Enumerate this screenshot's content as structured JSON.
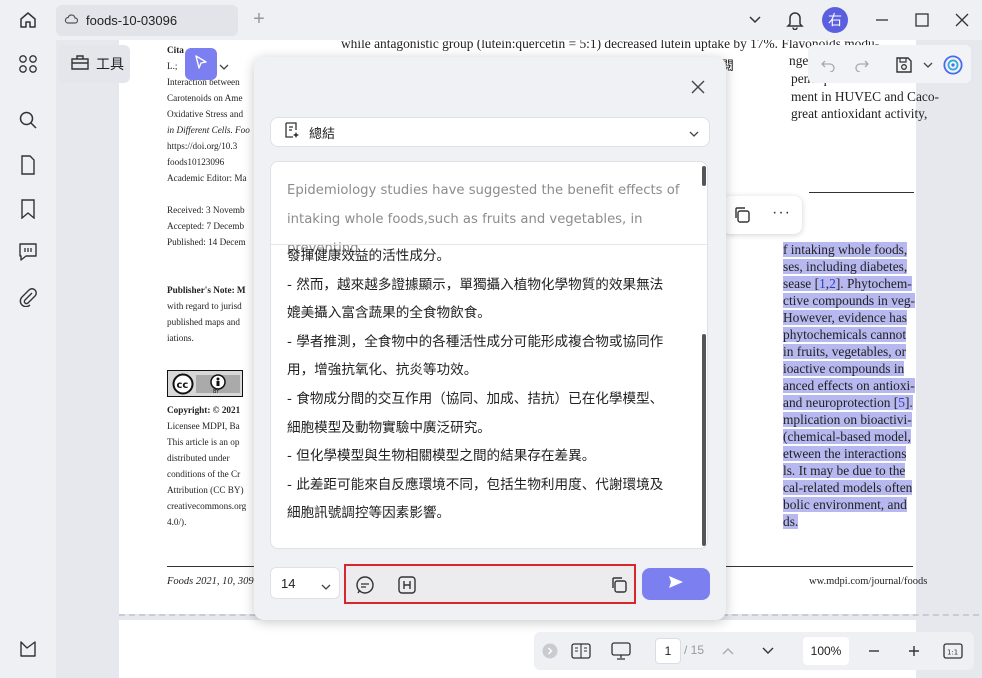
{
  "titlebar": {
    "tab_title": "foods-10-03096",
    "tab_add": "+",
    "avatar_text": "右"
  },
  "toolbar": {
    "tools_label": "工具",
    "partial_label": "閱"
  },
  "document": {
    "left_column": [
      "Cita",
      "L.;",
      "Interaction between",
      "Carotenoids on Ame",
      "Oxidative Stress and",
      "in Different Cells. Foo",
      "https://doi.org/10.3",
      "foods10123096",
      "",
      "Academic Editor: Ma",
      "",
      "Received: 3 Novemb",
      "Accepted: 7 Decemb",
      "Published: 14 Decem",
      "",
      "",
      "Publisher's Note: M",
      "with regard to jurisd",
      "published maps and",
      "iations."
    ],
    "copyright_lines": [
      "Copyright:  ©  2021",
      "Licensee  MDPI,  Ba",
      "This  article  is  an  op",
      "distributed    under",
      "conditions of the Cr",
      "Attribution (CC BY)",
      "creativecommons.org",
      "4.0/)."
    ],
    "right_top_lines": [
      "while antagonistic group (lutein:quercetin = 5:1) decreased lutein uptake by 17%. Flavonoids modu-",
      "nger recep",
      "pene:quer",
      "ment in HUVEC and Caco-",
      "great antioxidant activity,"
    ],
    "highlight_lines": [
      "f intaking whole foods,",
      "ses, including diabetes,",
      "sease [1,2]. Phytochem-",
      "ctive compounds in veg-",
      "However, evidence has",
      "phytochemicals cannot",
      "in fruits, vegetables, or",
      "ioactive compounds in",
      "anced effects on antioxi-",
      "and neuroprotection [5].",
      "mplication on bioactivi-",
      " (chemical-based model,",
      "etween the interactions",
      "ls. It may be due to the",
      "cal-related models often",
      "bolic environment, and",
      "ds."
    ],
    "footer_left": "Foods 2021, 10, 309",
    "footer_right": "ww.mdpi.com/journal/foods"
  },
  "panel": {
    "mode_label": "總結",
    "source_lines": [
      "Epidemiology studies have suggested the benefit effects of",
      "intaking whole foods,such as fruits and vegetables, in preventing"
    ],
    "summary_lines": [
      "發揮健康效益的活性成分。",
      "- 然而，越來越多證據顯示，單獨攝入植物化學物質的效果無法",
      "媲美攝入富含蔬果的全食物飲食。",
      "- 學者推測，全食物中的各種活性成分可能形成複合物或協同作",
      "用，增強抗氧化、抗炎等功效。",
      "- 食物成分間的交互作用（協同、加成、拮抗）已在化學模型、",
      "細胞模型及動物實驗中廣泛研究。",
      "- 但化學模型與生物相關模型之間的結果存在差異。",
      "- 此差距可能來自反應環境不同，包括生物利用度、代謝環境及",
      "細胞訊號調控等因素影響。"
    ],
    "font_size": "14"
  },
  "bottombar": {
    "page_current": "1",
    "page_total": "/ 15",
    "zoom": "100%"
  },
  "colors": {
    "accent": "#7b7ff0",
    "highlight": "#b7b8ef",
    "red_outline": "#d9262c"
  }
}
